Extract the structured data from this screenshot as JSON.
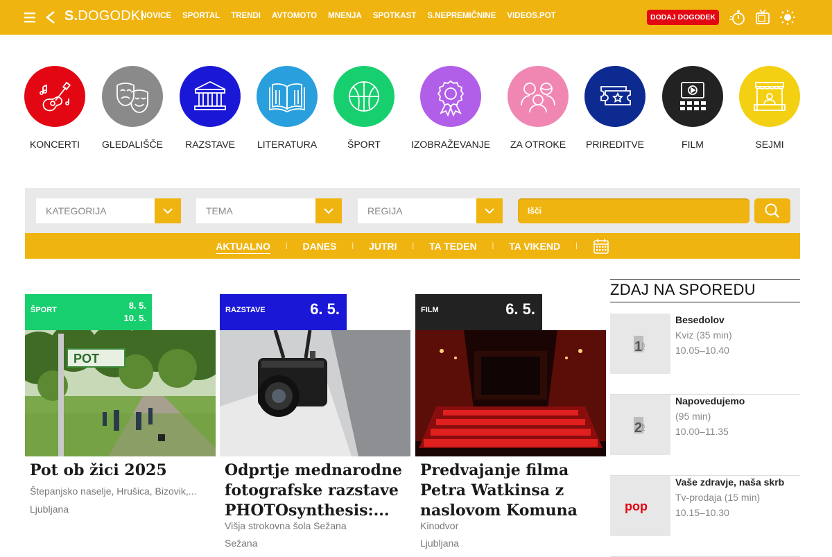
{
  "header": {
    "logo_bold": "S.",
    "logo_rest": "DOGODKI",
    "nav": [
      "NOVICE",
      "SPORTAL",
      "TRENDI",
      "AVTOMOTO",
      "MNENJA",
      "SPOTKAST",
      "S.NEPREMIČNINE",
      "VIDEOS.POT"
    ],
    "add_event": "DODAJ DOGODEK",
    "icons": [
      "menu-icon",
      "back-icon",
      "stopwatch-icon",
      "tv-icon",
      "sun-icon"
    ]
  },
  "categories": [
    {
      "label": "KONCERTI",
      "color": "#e30613",
      "icon": "guitar-icon"
    },
    {
      "label": "GLEDALIŠČE",
      "color": "#8a8a8a",
      "icon": "theater-masks-icon"
    },
    {
      "label": "RAZSTAVE",
      "color": "#1a18d6",
      "icon": "museum-icon"
    },
    {
      "label": "LITERATURA",
      "color": "#2a9fde",
      "icon": "book-icon"
    },
    {
      "label": "ŠPORT",
      "color": "#17cf6e",
      "icon": "ball-icon"
    },
    {
      "label": "IZOBRAŽEVANJE",
      "color": "#b15ee8",
      "icon": "award-icon"
    },
    {
      "label": "ZA OTROKE",
      "color": "#f087b3",
      "icon": "family-icon"
    },
    {
      "label": "PRIREDITVE",
      "color": "#0d2a91",
      "icon": "tickets-icon"
    },
    {
      "label": "FILM",
      "color": "#222222",
      "icon": "cinema-icon"
    },
    {
      "label": "SEJMI",
      "color": "#f4d013",
      "icon": "market-stall-icon"
    }
  ],
  "filters": {
    "category_placeholder": "KATEGORIJA",
    "topic_placeholder": "TEMA",
    "region_placeholder": "REGIJA",
    "search_placeholder": "Išči"
  },
  "tabs": [
    "AKTUALNO",
    "DANES",
    "JUTRI",
    "TA TEDEN",
    "TA VIKEND"
  ],
  "active_tab": "AKTUALNO",
  "cards": [
    {
      "category": "ŠPORT",
      "date_from": "8. 5.",
      "date_to": "10. 5.",
      "color": "#17cf6e",
      "title": "Pot ob žici 2025",
      "venue": "Štepanjsko naselje, Hrušica, Bizovik,...",
      "city": "Ljubljana"
    },
    {
      "category": "RAZSTAVE",
      "date": "6. 5.",
      "color": "#1a18d6",
      "title": "Odprtje mednarodne fotografske razstave PHOTOsynthesis:...",
      "venue": "Višja strokovna šola Sežana",
      "city": "Sežana"
    },
    {
      "category": "FILM",
      "date": "6. 5.",
      "color": "#222222",
      "title": "Predvajanje filma Petra Watkinsa z naslovom Komuna",
      "venue": "Kinodvor",
      "city": "Ljubljana"
    }
  ],
  "sidebar": {
    "title": "ZDAJ NA SPOREDU",
    "programs": [
      {
        "title": "Besedolov",
        "genre": "Kviz (35 min)",
        "time": "10.05–10.40",
        "channel": "1"
      },
      {
        "title": "Napovedujemo",
        "genre": "(95 min)",
        "time": "10.00–11.35",
        "channel": "2"
      },
      {
        "title": "Vaše zdravje, naša skrb",
        "genre": "Tv-prodaja (15 min)",
        "time": "10.15–10.30",
        "channel": "pop"
      }
    ]
  }
}
